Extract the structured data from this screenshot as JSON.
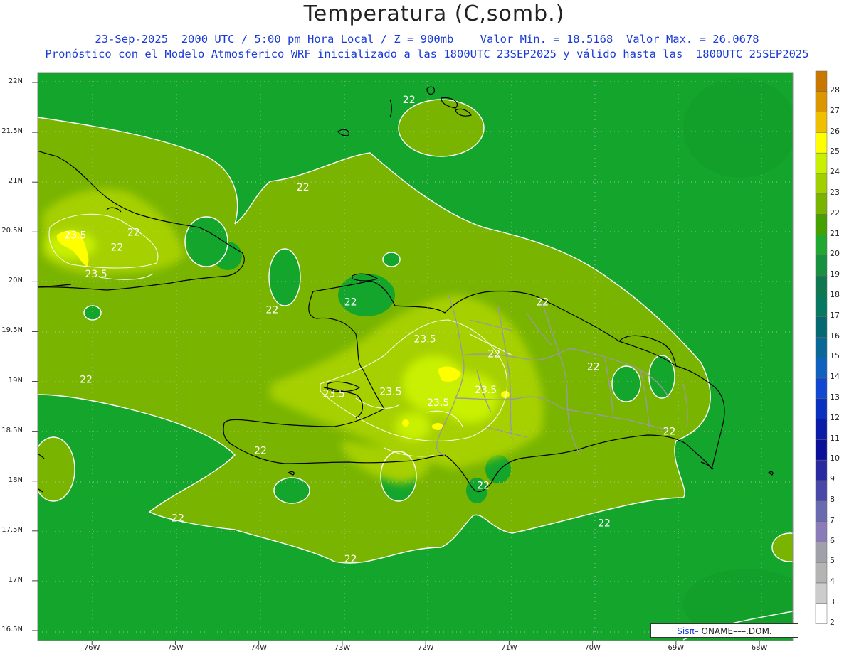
{
  "header": {
    "title": "Temperatura (C,somb.)",
    "subtitle_1": "23-Sep-2025  2000 UTC / 5:00 pm Hora Local / Z = 900mb    Valor Min. = 18.5168  Valor Max. = 26.0678",
    "subtitle_2": "Pronóstico con el Modelo Atmosferico WRF inicializado a las 1800UTC_23SEP2025 y válido hasta las  1800UTC_25SEP2025"
  },
  "axes": {
    "lat_labels": [
      "22N",
      "21.5N",
      "21N",
      "20.5N",
      "20N",
      "19.5N",
      "19N",
      "18.5N",
      "18N",
      "17.5N",
      "17N",
      "16.5N"
    ],
    "lon_labels": [
      "76W",
      "75W",
      "74W",
      "73W",
      "72W",
      "71W",
      "70W",
      "69W",
      "68W"
    ],
    "lat_range": [
      16.4,
      22.1
    ],
    "lon_range": [
      -76.65,
      -67.6
    ],
    "grid": "dotted"
  },
  "colorbar": {
    "ticks": [
      "28",
      "27",
      "26",
      "25",
      "24",
      "23",
      "22",
      "21",
      "20",
      "19",
      "18",
      "17",
      "16",
      "15",
      "14",
      "13",
      "12",
      "11",
      "10",
      "9",
      "8",
      "7",
      "6",
      "5",
      "4",
      "3",
      "2"
    ],
    "colors": [
      "#c87800",
      "#dc9600",
      "#f0c000",
      "#ffff00",
      "#c8f000",
      "#a0d000",
      "#78b400",
      "#46a000",
      "#20a830",
      "#189040",
      "#107850",
      "#087860",
      "#066870",
      "#0a6898",
      "#1060c0",
      "#1048d0",
      "#0a30c0",
      "#0a1ca8",
      "#0c1098",
      "#2a2aa0",
      "#4848a8",
      "#6a6ab0",
      "#8a7cb8",
      "#a0a0a8",
      "#b4b4b4",
      "#cccccc",
      "#ffffff"
    ]
  },
  "palette": {
    "background_green": "#14a52c",
    "light_green": "#78b400",
    "yellow_green": "#a6d000",
    "yellow": "#ffff00",
    "contour_white": "#ffffff",
    "coast_black": "#000000",
    "border_gray": "#9a9a9a"
  },
  "contour_labels": [
    {
      "text": "22",
      "lon": -72.2,
      "lat": 21.83
    },
    {
      "text": "22",
      "lon": -73.47,
      "lat": 20.95
    },
    {
      "text": "22",
      "lon": -75.5,
      "lat": 20.5
    },
    {
      "text": "22",
      "lon": -75.7,
      "lat": 20.35
    },
    {
      "text": "23.5",
      "lon": -76.2,
      "lat": 20.47
    },
    {
      "text": "23.5",
      "lon": -75.95,
      "lat": 20.08
    },
    {
      "text": "22",
      "lon": -73.84,
      "lat": 19.72
    },
    {
      "text": "22",
      "lon": -72.9,
      "lat": 19.8
    },
    {
      "text": "22",
      "lon": -70.6,
      "lat": 19.8
    },
    {
      "text": "23.5",
      "lon": -72.01,
      "lat": 19.43
    },
    {
      "text": "22",
      "lon": -71.18,
      "lat": 19.28
    },
    {
      "text": "22",
      "lon": -69.99,
      "lat": 19.15
    },
    {
      "text": "22",
      "lon": -76.07,
      "lat": 19.02
    },
    {
      "text": "23.5",
      "lon": -73.1,
      "lat": 18.88
    },
    {
      "text": "23.5",
      "lon": -72.42,
      "lat": 18.9
    },
    {
      "text": "23.5",
      "lon": -71.85,
      "lat": 18.79
    },
    {
      "text": "23.5",
      "lon": -71.28,
      "lat": 18.92
    },
    {
      "text": "22",
      "lon": -69.08,
      "lat": 18.5
    },
    {
      "text": "22",
      "lon": -73.98,
      "lat": 18.31
    },
    {
      "text": "22",
      "lon": -71.31,
      "lat": 17.96
    },
    {
      "text": "22",
      "lon": -74.97,
      "lat": 17.63
    },
    {
      "text": "22",
      "lon": -69.86,
      "lat": 17.58
    },
    {
      "text": "22",
      "lon": -72.9,
      "lat": 17.22
    }
  ],
  "credit": {
    "prefix": "Sisπ–",
    "suffix": " ONAME–––.DOM."
  }
}
